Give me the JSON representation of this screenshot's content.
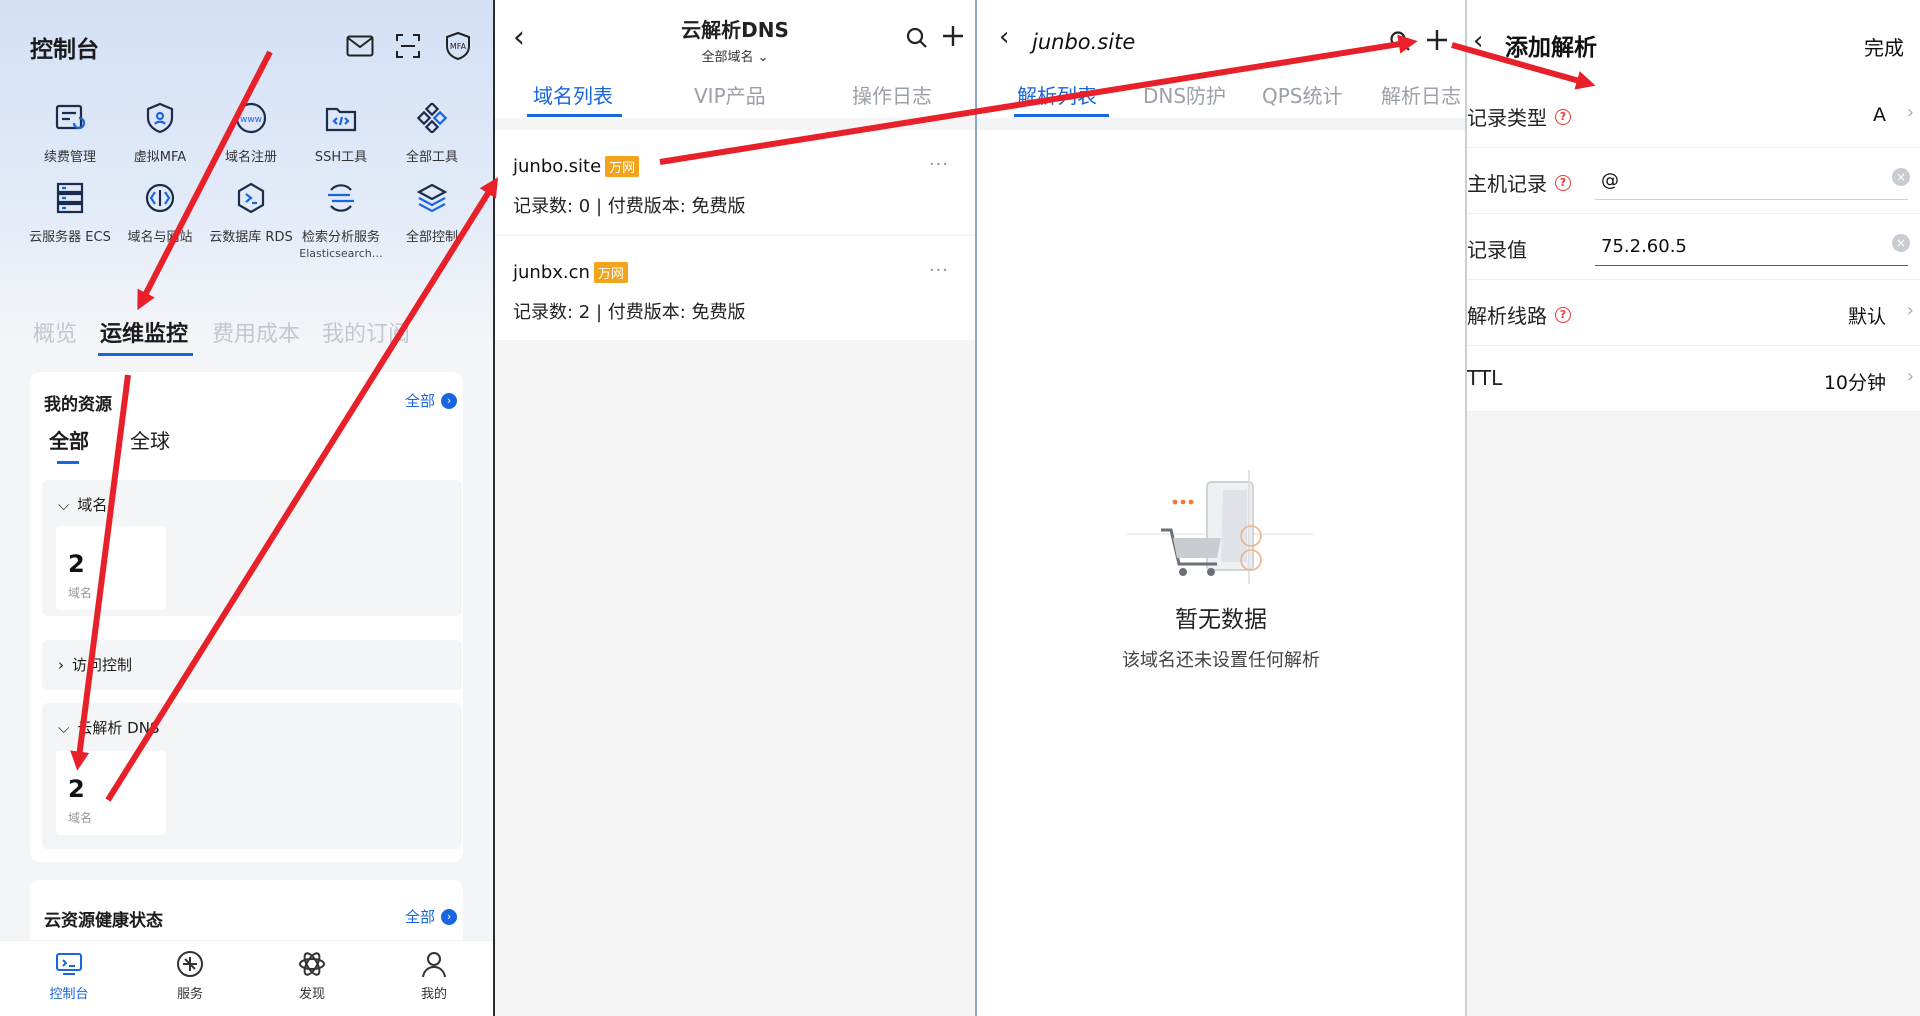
{
  "console": {
    "title": "控制台",
    "header_icons": [
      "mail-icon",
      "scan-icon",
      "mfa-icon"
    ],
    "mfa_text": "MFA",
    "www_text": "www",
    "tools": [
      {
        "label": "续费管理",
        "icon": "renewal-icon"
      },
      {
        "label": "虚拟MFA",
        "icon": "shield-icon"
      },
      {
        "label": "域名注册",
        "icon": "www-icon"
      },
      {
        "label": "SSH工具",
        "icon": "folder-code-icon"
      },
      {
        "label": "全部工具",
        "icon": "grid-icon"
      },
      {
        "label": "云服务器 ECS",
        "icon": "server-icon"
      },
      {
        "label": "域名与网站",
        "icon": "domain-icon"
      },
      {
        "label": "云数据库 RDS",
        "icon": "database-icon"
      },
      {
        "label": "检索分析服务",
        "label2": "Elasticsearch…",
        "icon": "search-analytics-icon"
      },
      {
        "label": "全部控制",
        "icon": "layers-icon"
      }
    ],
    "tabs": [
      "概览",
      "运维监控",
      "费用成本",
      "我的订阅"
    ],
    "active_tab": 1,
    "my_resources": {
      "title": "我的资源",
      "all_link": "全部",
      "subtabs": [
        "全部",
        "全球"
      ],
      "groups": [
        {
          "name": "域名",
          "expanded": true,
          "count": "2",
          "unit": "域名"
        },
        {
          "name": "访问控制",
          "expanded": false
        },
        {
          "name": "云解析 DNS",
          "expanded": true,
          "count": "2",
          "unit": "域名"
        }
      ]
    },
    "health": {
      "title": "云资源健康状态",
      "all_link": "全部"
    },
    "bottom_nav": [
      {
        "label": "控制台",
        "icon": "console-icon",
        "active": true
      },
      {
        "label": "服务",
        "icon": "service-icon",
        "active": false
      },
      {
        "label": "发现",
        "icon": "discover-icon",
        "active": false
      },
      {
        "label": "我的",
        "icon": "user-icon",
        "active": false
      }
    ]
  },
  "dns_list": {
    "title": "云解析DNS",
    "subtitle": "全部域名 ⌄",
    "tabs": [
      "域名列表",
      "VIP产品",
      "操作日志"
    ],
    "domains": [
      {
        "name": "junbo.site",
        "badge": "万网",
        "info": "记录数: 0 | 付费版本: 免费版",
        "more": "···"
      },
      {
        "name": "junbx.cn",
        "badge": "万网",
        "info": "记录数: 2 | 付费版本: 免费版",
        "more": "···"
      }
    ]
  },
  "domain_detail": {
    "title": "junbo.site",
    "tabs": [
      "解析列表",
      "DNS防护",
      "QPS统计",
      "解析日志"
    ],
    "empty_title": "暂无数据",
    "empty_sub": "该域名还未设置任何解析"
  },
  "add_record": {
    "title": "添加解析",
    "done": "完成",
    "fields": [
      {
        "label": "记录类型",
        "help": true,
        "value": "A",
        "type": "select"
      },
      {
        "label": "主机记录",
        "help": true,
        "value": "@",
        "type": "input"
      },
      {
        "label": "记录值",
        "help": false,
        "value": "75.2.60.5",
        "type": "input",
        "focused": true
      },
      {
        "label": "解析线路",
        "help": true,
        "value": "默认",
        "type": "select"
      },
      {
        "label": "TTL",
        "help": false,
        "value": "10分钟",
        "type": "select"
      }
    ]
  },
  "colors": {
    "accent": "#1a66e0",
    "arrow": "#e8202a",
    "badge": "#f3a41a",
    "help": "#e53935"
  }
}
